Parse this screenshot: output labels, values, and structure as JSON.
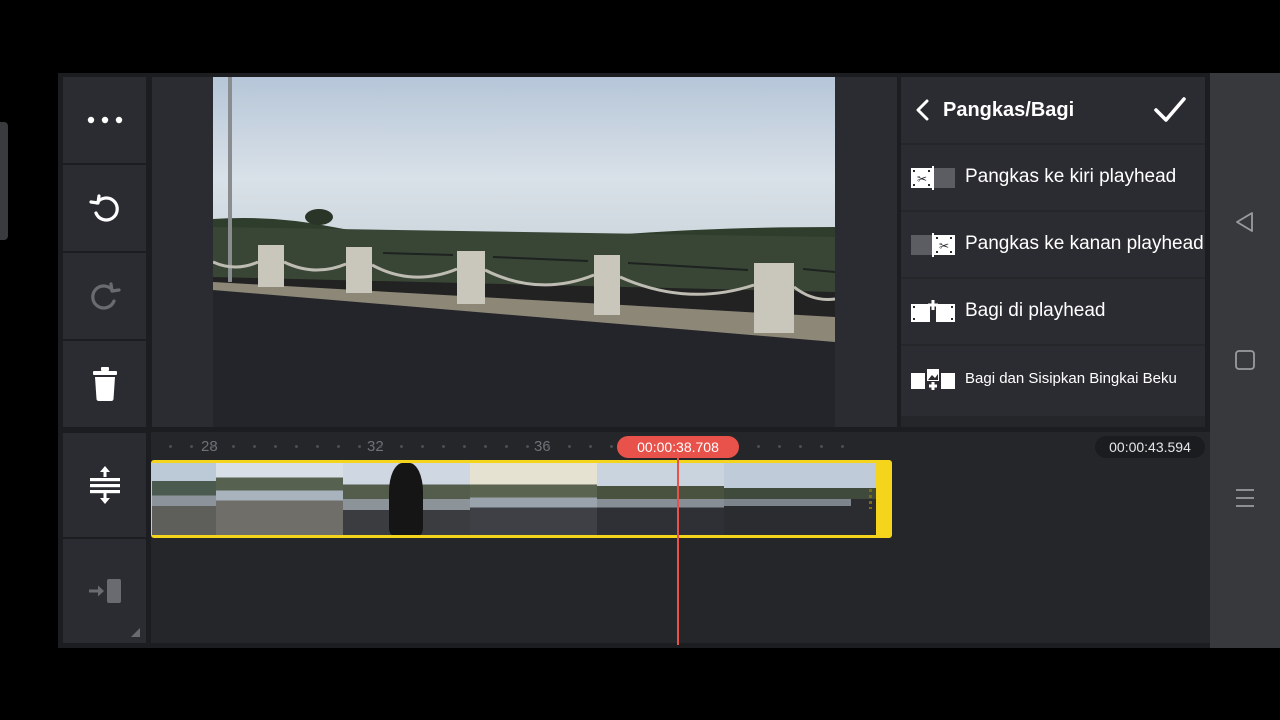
{
  "panel": {
    "title": "Pangkas/Bagi",
    "items": [
      {
        "label": "Pangkas ke kiri playhead",
        "icon": "trim-left-icon"
      },
      {
        "label": "Pangkas ke kanan playhead",
        "icon": "trim-right-icon"
      },
      {
        "label": "Bagi di playhead",
        "icon": "split-icon"
      },
      {
        "label": "Bagi dan Sisipkan Bingkai Beku",
        "icon": "split-freeze-frame-icon"
      }
    ]
  },
  "timeline": {
    "ruler_labels": [
      "28",
      "32",
      "36"
    ],
    "current_time": "00:00:38.708",
    "end_time": "00:00:43.594"
  },
  "toolbar": {
    "icons": [
      "more-icon",
      "undo-icon",
      "redo-icon",
      "delete-icon",
      "timeline-zoom-icon",
      "jump-to-end-icon"
    ]
  },
  "colors": {
    "accent": "#f5d51c",
    "playhead": "#e8524a",
    "panel_bg": "#2b2c31"
  }
}
